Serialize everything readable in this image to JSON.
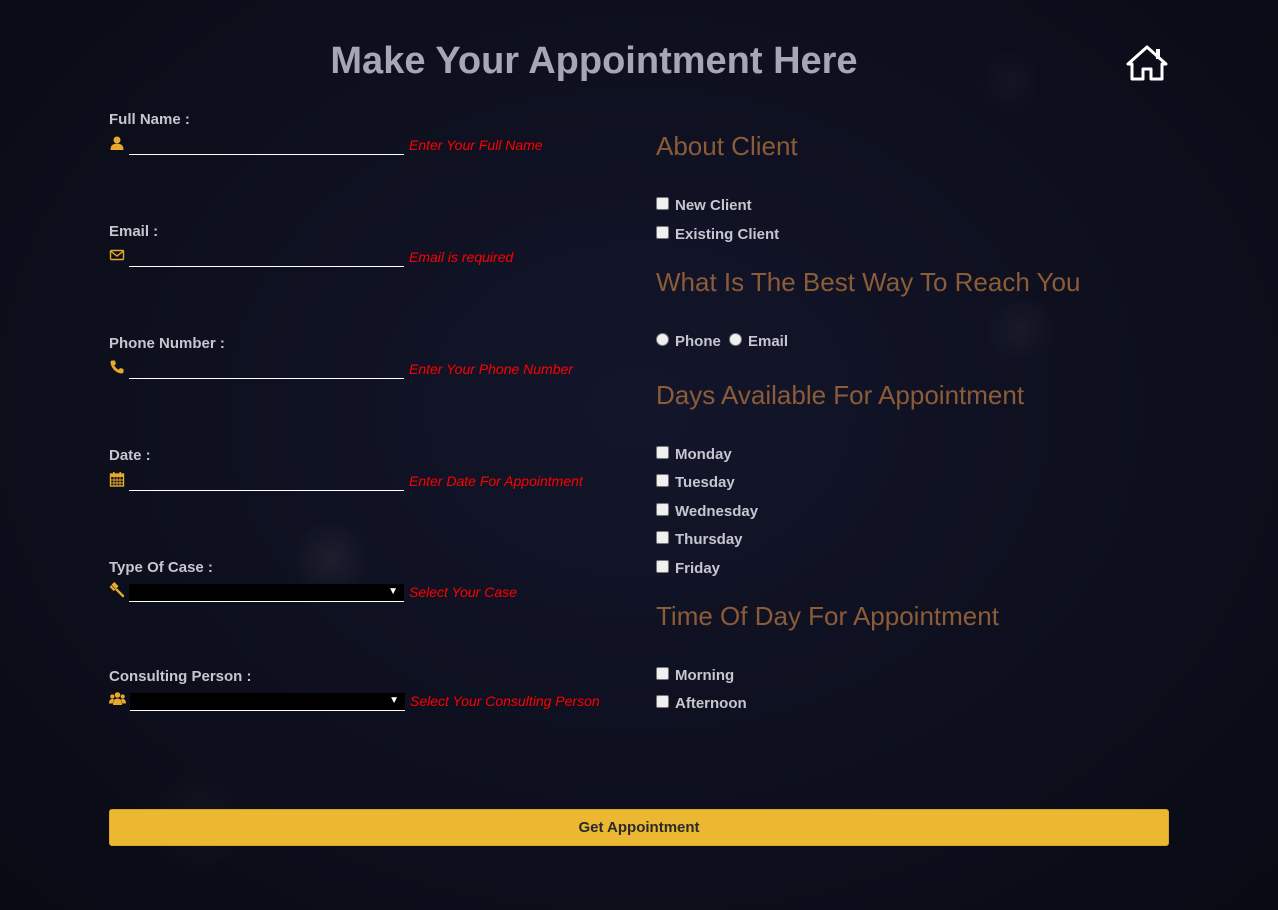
{
  "page": {
    "title": "Make Your Appointment Here",
    "home_icon": "home-icon"
  },
  "colors": {
    "background": "#13162b",
    "accent": "#ecb731",
    "section_heading": "#8c5b37",
    "error": "#ff0000",
    "label": "#c7c5cf"
  },
  "form": {
    "full_name": {
      "label": "Full Name :",
      "icon": "user-icon",
      "value": "",
      "error": "Enter Your Full Name"
    },
    "email": {
      "label": "Email :",
      "icon": "envelope-icon",
      "value": "",
      "error": "Email is required"
    },
    "phone": {
      "label": "Phone Number :",
      "icon": "phone-icon",
      "value": "",
      "error": "Enter Your Phone Number"
    },
    "date": {
      "label": "Date :",
      "icon": "calendar-icon",
      "value": "",
      "error": "Enter Date For Appointment"
    },
    "case_type": {
      "label": "Type Of Case :",
      "icon": "gavel-icon",
      "value": "",
      "error": "Select Your Case"
    },
    "consulting_person": {
      "label": "Consulting Person :",
      "icon": "users-icon",
      "value": "",
      "error": "Select Your Consulting Person"
    }
  },
  "about_client": {
    "heading": "About Client",
    "options": [
      "New Client",
      "Existing Client"
    ]
  },
  "reach": {
    "heading": "What Is The Best Way To Reach You",
    "options": [
      "Phone",
      "Email"
    ]
  },
  "days": {
    "heading": "Days Available For Appointment",
    "options": [
      "Monday",
      "Tuesday",
      "Wednesday",
      "Thursday",
      "Friday"
    ]
  },
  "time_of_day": {
    "heading": "Time Of Day For Appointment",
    "options": [
      "Morning",
      "Afternoon"
    ]
  },
  "submit": {
    "label": "Get Appointment"
  }
}
